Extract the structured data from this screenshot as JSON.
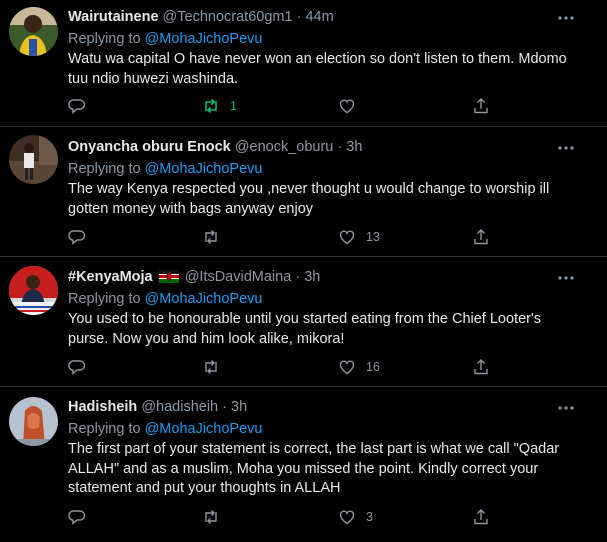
{
  "tweets": [
    {
      "name": "Wairutainene",
      "handle": "@Technocrat60gm1",
      "time": "44m",
      "replying_prefix": "Replying to",
      "replying_to": "@MohaJichoPevu",
      "body": "Watu wa capital O have never won an election so don't listen to them. Mdomo tuu ndio huwezi washinda.",
      "replies": "",
      "retweets": "1",
      "likes": "",
      "retweeted": true
    },
    {
      "name": "Onyancha oburu Enock",
      "handle": "@enock_oburu",
      "time": "3h",
      "replying_prefix": "Replying to",
      "replying_to": "@MohaJichoPevu",
      "body": "The way Kenya respected you ,never thought u would change to worship ill gotten money with bags anyway enjoy",
      "replies": "",
      "retweets": "",
      "likes": "13"
    },
    {
      "name": "#KenyaMoja",
      "handle": "@ItsDavidMaina",
      "time": "3h",
      "replying_prefix": "Replying to",
      "replying_to": "@MohaJichoPevu",
      "body": "You used to be honourable until you started eating from the Chief Looter's purse. Now you and him look alike, mikora!",
      "replies": "",
      "retweets": "",
      "likes": "16"
    },
    {
      "name": "Hadisheih",
      "handle": "@hadisheih",
      "time": "3h",
      "replying_prefix": "Replying to",
      "replying_to": "@MohaJichoPevu",
      "body": "The first part of your statement is correct, the last part is what we call \"Qadar ALLAH\" and as a muslim, Moha you missed the point. Kindly correct your statement  and put your thoughts in ALLAH",
      "replies": "",
      "retweets": "",
      "likes": "3"
    }
  ],
  "separator": "·",
  "colors": {
    "background": "#000000",
    "text": "#e7e9ea",
    "muted": "#8b98a5",
    "link": "#1d9bf0",
    "retweet_active": "#00ba7c",
    "divider": "#2f3336"
  },
  "icons": {
    "reply": "reply-icon",
    "retweet": "retweet-icon",
    "like": "heart-icon",
    "share": "share-icon",
    "more": "more-icon",
    "flag": "kenya-flag-icon"
  }
}
